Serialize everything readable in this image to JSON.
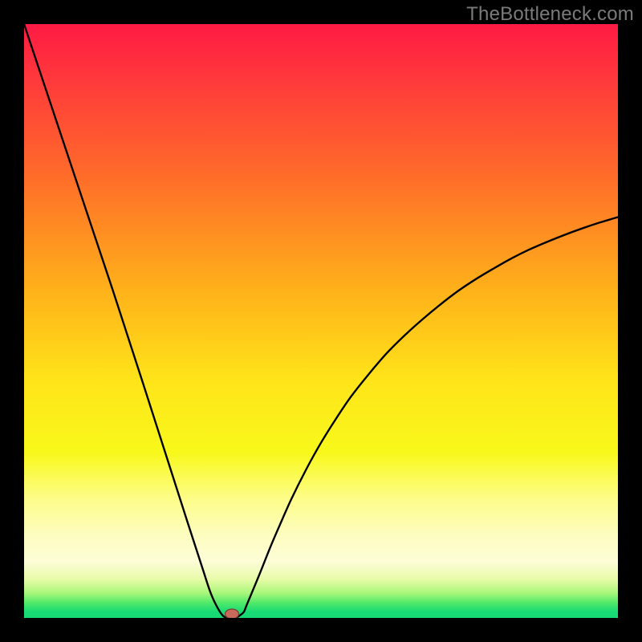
{
  "attribution": "TheBottleneck.com",
  "chart_data": {
    "type": "line",
    "title": "",
    "xlabel": "",
    "ylabel": "",
    "xlim": [
      0,
      100
    ],
    "ylim": [
      0,
      100
    ],
    "background": {
      "stops": [
        {
          "offset": 0.0,
          "color": "#ff1a44"
        },
        {
          "offset": 0.1,
          "color": "#ff3b3b"
        },
        {
          "offset": 0.25,
          "color": "#ff6a2a"
        },
        {
          "offset": 0.45,
          "color": "#ffb21a"
        },
        {
          "offset": 0.6,
          "color": "#ffe41a"
        },
        {
          "offset": 0.72,
          "color": "#f8f81a"
        },
        {
          "offset": 0.8,
          "color": "#fdfd8a"
        },
        {
          "offset": 0.86,
          "color": "#fdfdc0"
        },
        {
          "offset": 0.905,
          "color": "#fdfdd8"
        },
        {
          "offset": 0.935,
          "color": "#e8fba8"
        },
        {
          "offset": 0.958,
          "color": "#a8f77a"
        },
        {
          "offset": 0.975,
          "color": "#4fe96a"
        },
        {
          "offset": 0.99,
          "color": "#18da74"
        },
        {
          "offset": 1.0,
          "color": "#18da74"
        }
      ]
    },
    "series": [
      {
        "name": "bottleneck-curve",
        "x": [
          0.0,
          2.5,
          5.0,
          7.5,
          10.0,
          12.5,
          15.0,
          17.5,
          20.0,
          22.5,
          25.0,
          27.5,
          30.0,
          31.5,
          33.0,
          34.0,
          34.8,
          35.6,
          36.3,
          37.0,
          37.5,
          39.5,
          41.5,
          43.0,
          45.0,
          47.5,
          50.0,
          52.5,
          55.0,
          58.0,
          61.0,
          64.0,
          67.0,
          70.0,
          73.0,
          76.0,
          79.0,
          82.0,
          85.0,
          88.0,
          91.0,
          94.0,
          97.0,
          100.0
        ],
        "y": [
          100.0,
          92.5,
          85.0,
          77.5,
          70.0,
          62.5,
          55.0,
          47.3,
          39.6,
          31.8,
          24.0,
          16.2,
          8.5,
          4.0,
          1.0,
          0.0,
          0.0,
          0.0,
          0.4,
          1.0,
          2.2,
          7.0,
          12.0,
          15.5,
          20.0,
          25.0,
          29.5,
          33.5,
          37.2,
          41.0,
          44.5,
          47.5,
          50.2,
          52.7,
          55.0,
          57.0,
          58.8,
          60.5,
          62.0,
          63.3,
          64.5,
          65.6,
          66.6,
          67.5
        ]
      }
    ],
    "marker": {
      "x": 35.0,
      "y": 0.0,
      "fill": "#c86a5a",
      "stroke": "#7a3a30"
    }
  }
}
